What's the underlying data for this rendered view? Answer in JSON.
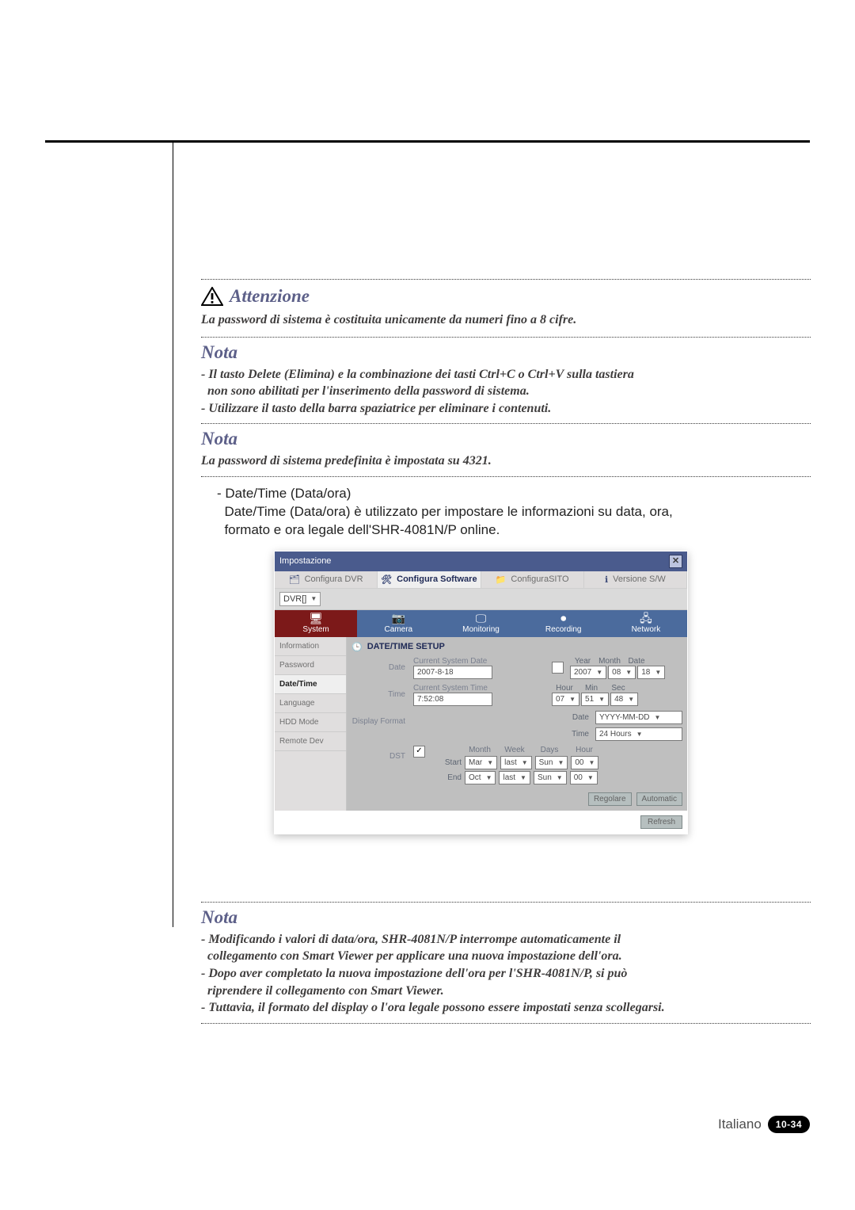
{
  "sections": {
    "attenzione": {
      "title": "Attenzione",
      "body": "La password di sistema è costituita unicamente da numeri fino a 8 cifre."
    },
    "nota1": {
      "title": "Nota",
      "items": [
        "- Il tasto Delete (Elimina) e la combinazione dei tasti Ctrl+C o Ctrl+V sulla tastiera\n  non sono abilitati per l'inserimento della password di sistema.",
        "- Utilizzare il tasto della barra spaziatrice per eliminare i contenuti."
      ]
    },
    "nota2": {
      "title": "Nota",
      "body": "La password di sistema predefinita è impostata su 4321."
    },
    "datetime_desc": "- Date/Time (Data/ora)\n  Date/Time (Data/ora) è utilizzato per impostare le informazioni su data, ora,\n  formato e ora legale dell'SHR-4081N/P online.",
    "nota3": {
      "title": "Nota",
      "items": [
        "- Modificando i valori di data/ora, SHR-4081N/P interrompe automaticamente il\n  collegamento con Smart Viewer per applicare una nuova impostazione dell'ora.",
        "- Dopo aver completato la nuova impostazione dell'ora per l'SHR-4081N/P, si può\n  riprendere il collegamento con Smart Viewer.",
        "- Tuttavia, il formato del display o l'ora legale possono essere impostati senza scollegarsi."
      ]
    }
  },
  "screenshot": {
    "window_title": "Impostazione",
    "close_x": "✕",
    "main_tabs": {
      "configura_dvr": "Configura DVR",
      "configura_software": "Configura Software",
      "configura_sito": "ConfiguraSITO",
      "versione_sw": "Versione S/W"
    },
    "dvr_select": "DVR[]",
    "inner_tabs": {
      "system": "System",
      "camera": "Camera",
      "monitoring": "Monitoring",
      "recording": "Recording",
      "network": "Network"
    },
    "sidemenu": [
      "Information",
      "Password",
      "Date/Time",
      "Language",
      "HDD Mode",
      "Remote Dev"
    ],
    "section_title": "DATE/TIME SETUP",
    "date": {
      "label": "Date",
      "caption": "Current System Date",
      "value": "2007-8-18",
      "cols": {
        "year": "Year",
        "month": "Month",
        "date": "Date"
      },
      "year_val": "2007",
      "month_val": "08",
      "date_val": "18"
    },
    "time": {
      "label": "Time",
      "caption": "Current System Time",
      "value": "7:52:08",
      "cols": {
        "hour": "Hour",
        "min": "Min",
        "sec": "Sec"
      },
      "hour_val": "07",
      "min_val": "51",
      "sec_val": "48"
    },
    "display_format": {
      "label": "Display Format",
      "date_label": "Date",
      "date_value": "YYYY-MM-DD",
      "time_label": "Time",
      "time_value": "24 Hours"
    },
    "dst": {
      "label": "DST",
      "check": "✓",
      "headers": {
        "month": "Month",
        "week": "Week",
        "days": "Days",
        "hour": "Hour"
      },
      "start_label": "Start",
      "start": {
        "month": "Mar",
        "week": "last",
        "day": "Sun",
        "hour": "00"
      },
      "end_label": "End",
      "end": {
        "month": "Oct",
        "week": "last",
        "day": "Sun",
        "hour": "00"
      }
    },
    "buttons": {
      "ok": "Regolare",
      "auto": "Automatic",
      "refresh": "Refresh"
    }
  },
  "footer": {
    "language": "Italiano",
    "page": "10-34"
  }
}
